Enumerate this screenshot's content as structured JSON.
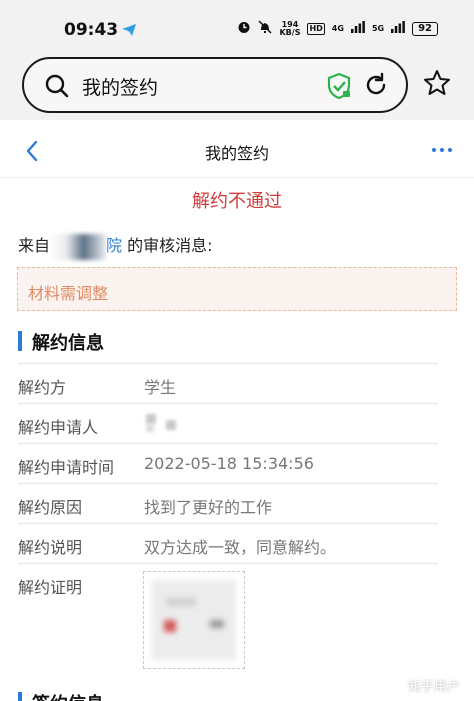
{
  "status_bar": {
    "time": "09:43",
    "net_speed_value": "194",
    "net_speed_unit": "KB/S",
    "hd_label": "HD",
    "net_4g": "4G",
    "net_5g": "5G",
    "battery": "92"
  },
  "browser": {
    "address_text": "我的签约"
  },
  "nav": {
    "title": "我的签约"
  },
  "result": {
    "status_title": "解约不通过",
    "from_prefix": "来自",
    "from_org_suffix": "院",
    "from_suffix": " 的审核消息:",
    "message": "材料需调整"
  },
  "section": {
    "title": "解约信息",
    "rows": [
      {
        "label": "解约方",
        "value": "学生"
      },
      {
        "label": "解约申请人",
        "value": ""
      },
      {
        "label": "解约申请时间",
        "value": "2022-05-18 15:34:56"
      },
      {
        "label": "解约原因",
        "value": "找到了更好的工作"
      },
      {
        "label": "解约说明",
        "value": "双方达成一致，同意解约。"
      },
      {
        "label": "解约证明",
        "value": ""
      }
    ]
  },
  "section2": {
    "title": "签约信息"
  },
  "watermark": "知乎用户",
  "colors": {
    "accent": "#2e7bd3",
    "error": "#d23b3b",
    "message_text": "#e08a63",
    "message_bg": "#fbf3f0",
    "shield": "#2fb24a"
  }
}
